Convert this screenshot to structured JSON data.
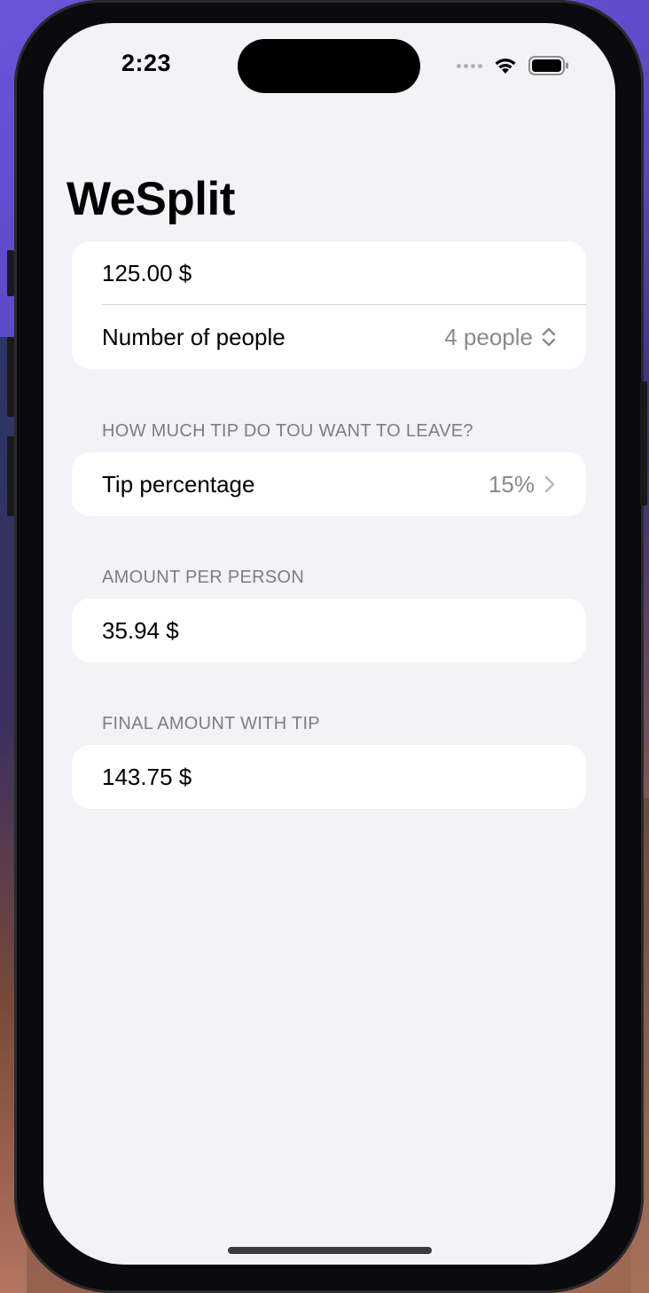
{
  "status_bar": {
    "time": "2:23",
    "icons": [
      "signal-dots-icon",
      "wifi-icon",
      "battery-icon"
    ]
  },
  "app": {
    "title": "WeSplit"
  },
  "check_section": {
    "amount_value": "125.00 $",
    "people_label": "Number of people",
    "people_value": "4 people",
    "people_icon": "chevron-up-down-icon"
  },
  "tip_section": {
    "header": "HOW MUCH TIP DO TOU WANT TO LEAVE?",
    "label": "Tip percentage",
    "value": "15%",
    "icon": "chevron-right-icon"
  },
  "per_person_section": {
    "header": "AMOUNT PER PERSON",
    "value": "35.94 $"
  },
  "total_section": {
    "header": "FINAL AMOUNT WITH TIP",
    "value": "143.75 $"
  },
  "colors": {
    "background": "#f2f2f7",
    "card": "#ffffff",
    "secondary_text": "#8a8a8e",
    "header_text": "#7d7d82"
  }
}
